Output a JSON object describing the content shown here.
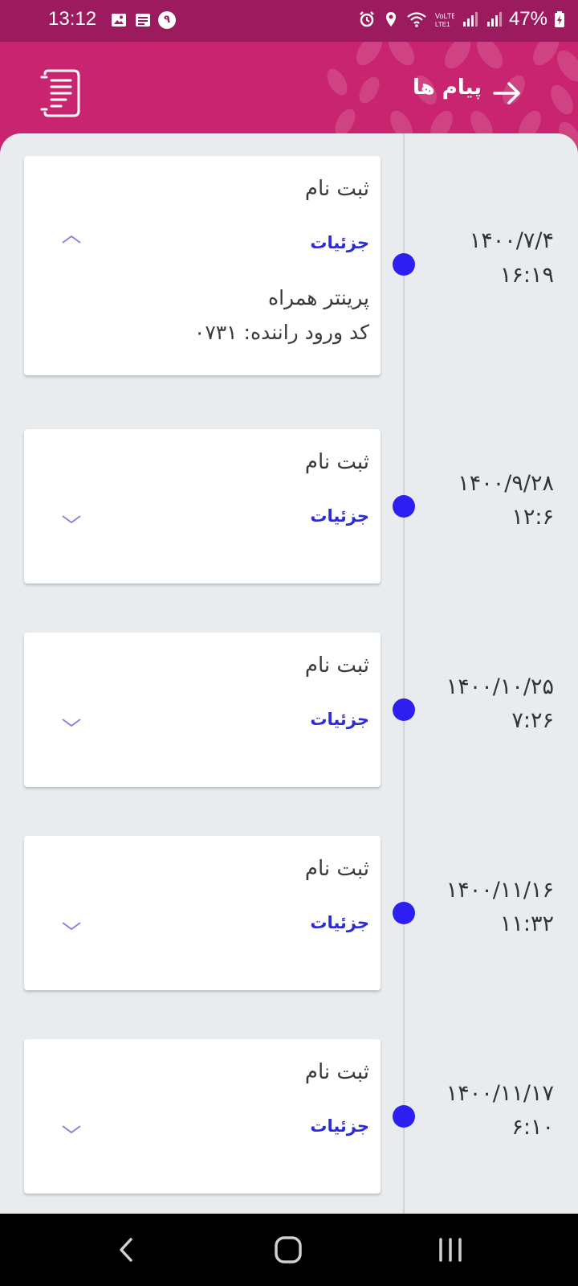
{
  "status_bar": {
    "time": "13:12",
    "notification_badge": "۹",
    "battery": "47%"
  },
  "header": {
    "title": "پیام ها",
    "colors": {
      "bar": "#c9246f",
      "status": "#9c1a5e"
    }
  },
  "messages": [
    {
      "title": "ثبت نام",
      "details_label": "جزئیات",
      "expanded": true,
      "detail_lines": [
        "پرینتر همراه",
        "کد ورود راننده: ۰۷۳۱"
      ],
      "date": "۱۴۰۰/۷/۴",
      "time": "۱۶:۱۹"
    },
    {
      "title": "ثبت نام",
      "details_label": "جزئیات",
      "expanded": false,
      "date": "۱۴۰۰/۹/۲۸",
      "time": "۱۲:۶"
    },
    {
      "title": "ثبت نام",
      "details_label": "جزئیات",
      "expanded": false,
      "date": "۱۴۰۰/۱۰/۲۵",
      "time": "۷:۲۶"
    },
    {
      "title": "ثبت نام",
      "details_label": "جزئیات",
      "expanded": false,
      "date": "۱۴۰۰/۱۱/۱۶",
      "time": "۱۱:۳۲"
    },
    {
      "title": "ثبت نام",
      "details_label": "جزئیات",
      "expanded": false,
      "date": "۱۴۰۰/۱۱/۱۷",
      "time": "۶:۱۰"
    }
  ],
  "accent_color": "#2d1ef2"
}
